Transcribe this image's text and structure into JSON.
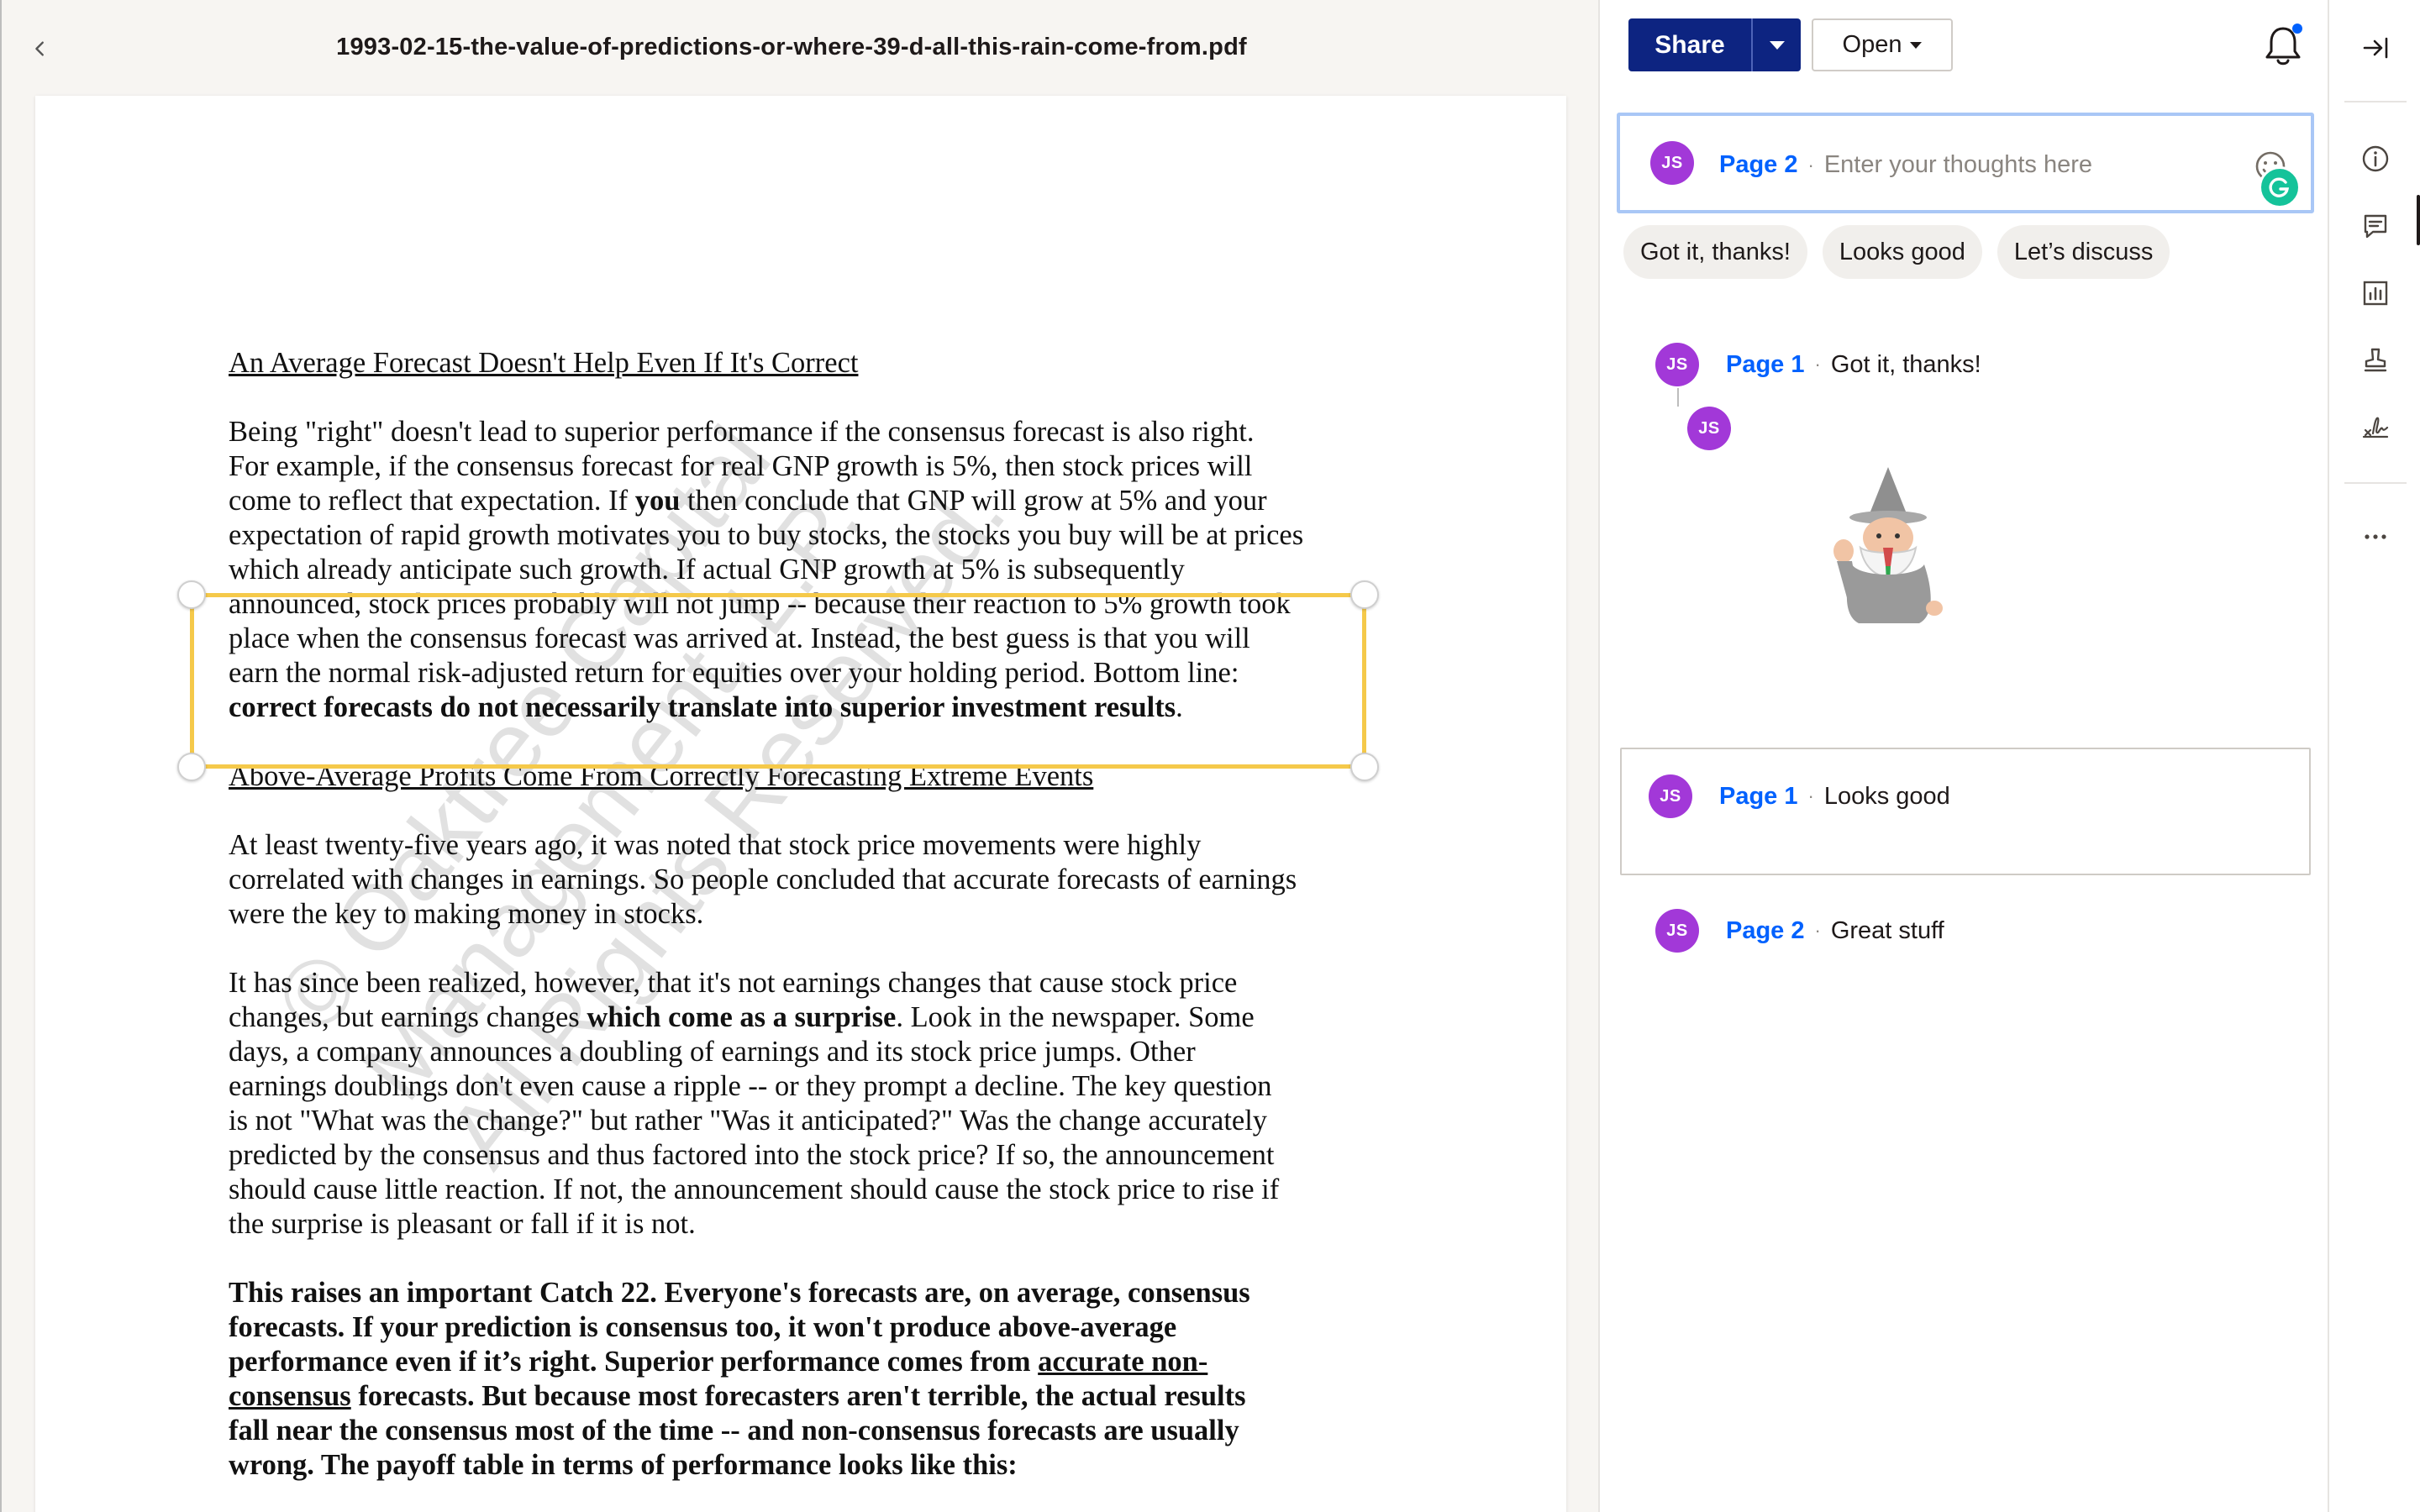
{
  "document": {
    "title": "1993-02-15-the-value-of-predictions-or-where-39-d-all-this-rain-come-from.pdf",
    "watermark": "© Oaktree Capital Management, L.P.\nAll Rights Reserved."
  },
  "page_text": {
    "heading1": "An Average Forecast Doesn't Help Even If It's Correct",
    "p1_lines": [
      "Being \"right\" doesn't lead to superior performance if the consensus forecast is also right.",
      "For example, if the consensus forecast for real GNP growth is 5%, then stock prices will",
      "come to reflect that expectation.  If ",
      "you",
      " then conclude that GNP will grow at 5% and your",
      "expectation of rapid growth motivates you to buy stocks, the stocks you buy will be at prices",
      "which already anticipate such growth.  If actual GNP growth at 5% is subsequently",
      "announced, stock prices probably will not jump -- because their reaction to 5% growth took",
      "place when the consensus forecast was arrived at.  Instead, the best guess is that you will",
      "earn the normal risk-adjusted return for equities over your holding period.  Bottom line:",
      "correct forecasts do not necessarily translate into superior investment results",
      "."
    ],
    "heading2": "Above-Average Profits Come From Correctly Forecasting Extreme Events",
    "p2_lines": [
      "At least twenty-five years ago, it was noted that stock price movements were highly",
      "correlated with changes in earnings.  So people concluded that accurate forecasts of earnings",
      "were the key to making money in stocks."
    ],
    "p3_lines": [
      "It has since been realized, however, that it's not earnings changes that cause stock price",
      "changes, but earnings changes ",
      "which come as a surprise",
      ".  Look in the newspaper. Some",
      "days, a company announces a doubling of earnings and its stock price jumps.  Other",
      "earnings doublings don't even cause a ripple -- or they prompt a decline.  The key question",
      "is not \"What was the change?\" but rather \"Was it anticipated?\"  Was the change accurately",
      "predicted by the consensus and thus factored into the stock price?  If so, the announcement",
      "should cause little reaction.  If not, the announcement should cause the stock price to rise if",
      "the surprise is pleasant or fall if it is not."
    ],
    "p4_lines": [
      "This raises an important Catch 22.  Everyone's forecasts are, on average, consensus",
      "forecasts. If your prediction is consensus too, it won't produce above-average",
      "performance even if it’s right.  Superior performance comes from ",
      "accurate non-",
      "consensus",
      " forecasts.  But because most forecasters aren't terrible, the actual results",
      "fall near the consensus most of the time -- and non-consensus forecasts are usually",
      "wrong.  The payoff table in terms of performance looks like this:"
    ]
  },
  "toolbar": {
    "share_label": "Share",
    "open_label": "Open"
  },
  "comment_input": {
    "avatar_initials": "JS",
    "page_label": "Page 2",
    "placeholder": "Enter your thoughts here"
  },
  "quick_replies": [
    "Got it, thanks!",
    "Looks good",
    "Let’s discuss"
  ],
  "threads": [
    {
      "avatar": "JS",
      "page": "Page 1",
      "text": "Got it, thanks!",
      "reply_avatar": "JS"
    },
    {
      "avatar": "JS",
      "page": "Page 1",
      "text": "Looks good"
    },
    {
      "avatar": "JS",
      "page": "Page 2",
      "text": "Great stuff"
    }
  ],
  "colors": {
    "share_bg": "#0d2481",
    "link": "#0061fe",
    "avatar": "#a238d8",
    "highlight": "#f5c94a",
    "grammarly": "#15c39a"
  },
  "icons": {
    "back": "chevron-left-icon",
    "bell": "bell-icon",
    "rail": [
      "collapse-panel-icon",
      "info-icon",
      "comment-icon",
      "chart-icon",
      "stamp-icon",
      "signature-icon",
      "more-icon"
    ]
  }
}
